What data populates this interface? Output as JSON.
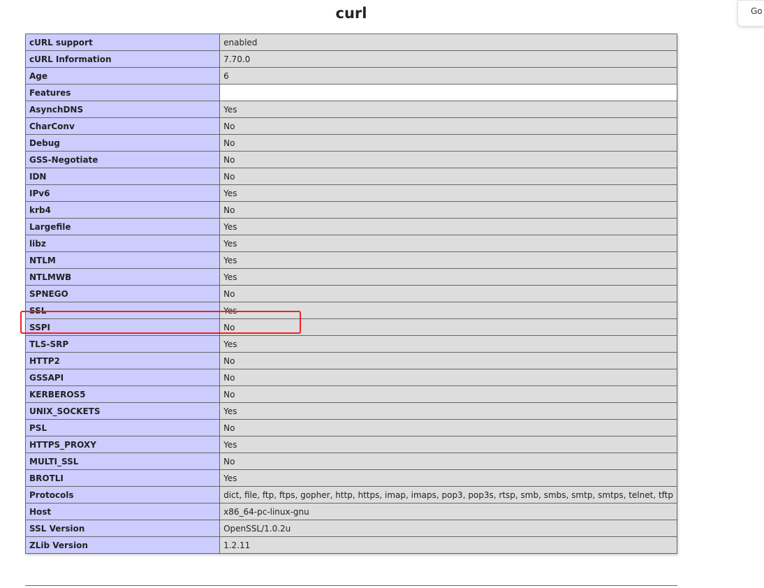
{
  "page": {
    "title": "curl",
    "floating_button_label": "Go"
  },
  "rows": [
    {
      "name": "cURL support",
      "value": "enabled"
    },
    {
      "name": "cURL Information",
      "value": "7.70.0"
    },
    {
      "name": "Age",
      "value": "6"
    },
    {
      "name": "Features",
      "value": ""
    },
    {
      "name": "AsynchDNS",
      "value": "Yes"
    },
    {
      "name": "CharConv",
      "value": "No"
    },
    {
      "name": "Debug",
      "value": "No"
    },
    {
      "name": "GSS-Negotiate",
      "value": "No"
    },
    {
      "name": "IDN",
      "value": "No"
    },
    {
      "name": "IPv6",
      "value": "Yes"
    },
    {
      "name": "krb4",
      "value": "No"
    },
    {
      "name": "Largefile",
      "value": "Yes"
    },
    {
      "name": "libz",
      "value": "Yes"
    },
    {
      "name": "NTLM",
      "value": "Yes"
    },
    {
      "name": "NTLMWB",
      "value": "Yes"
    },
    {
      "name": "SPNEGO",
      "value": "No"
    },
    {
      "name": "SSL",
      "value": "Yes"
    },
    {
      "name": "SSPI",
      "value": "No"
    },
    {
      "name": "TLS-SRP",
      "value": "Yes"
    },
    {
      "name": "HTTP2",
      "value": "No"
    },
    {
      "name": "GSSAPI",
      "value": "No"
    },
    {
      "name": "KERBEROS5",
      "value": "No"
    },
    {
      "name": "UNIX_SOCKETS",
      "value": "Yes"
    },
    {
      "name": "PSL",
      "value": "No"
    },
    {
      "name": "HTTPS_PROXY",
      "value": "Yes"
    },
    {
      "name": "MULTI_SSL",
      "value": "No"
    },
    {
      "name": "BROTLI",
      "value": "Yes"
    },
    {
      "name": "Protocols",
      "value": "dict, file, ftp, ftps, gopher, http, https, imap, imaps, pop3, pop3s, rtsp, smb, smbs, smtp, smtps, telnet, tftp"
    },
    {
      "name": "Host",
      "value": "x86_64-pc-linux-gnu"
    },
    {
      "name": "SSL Version",
      "value": "OpenSSL/1.0.2u"
    },
    {
      "name": "ZLib Version",
      "value": "1.2.11"
    }
  ],
  "highlight": {
    "color": "#ee2222"
  }
}
